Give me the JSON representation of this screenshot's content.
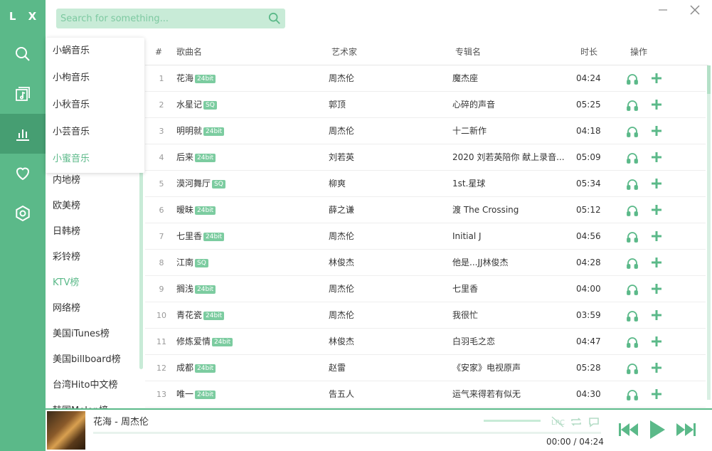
{
  "app": {
    "logo": "L X"
  },
  "colors": {
    "accent": "#5bb989",
    "accent_dark": "#469e72",
    "accent_light": "#c8ebd7"
  },
  "nav": [
    {
      "icon": "search-icon"
    },
    {
      "icon": "music-library-icon"
    },
    {
      "icon": "chart-icon",
      "active": true
    },
    {
      "icon": "heart-icon"
    },
    {
      "icon": "settings-icon"
    }
  ],
  "search": {
    "placeholder": "Search for something..."
  },
  "dropdown": {
    "items": [
      "小蜗音乐",
      "小枸音乐",
      "小秋音乐",
      "小芸音乐",
      "小蜜音乐"
    ],
    "selected": "小蜜音乐"
  },
  "boards": {
    "items": [
      "内地榜",
      "欧美榜",
      "日韩榜",
      "彩铃榜",
      "KTV榜",
      "网络榜",
      "美国iTunes榜",
      "美国billboard榜",
      "台湾Hito中文榜",
      "韩国Melon榜"
    ],
    "selected": "KTV榜"
  },
  "table": {
    "headers": {
      "idx": "#",
      "name": "歌曲名",
      "artist": "艺术家",
      "album": "专辑名",
      "duration": "时长",
      "actions": "操作"
    },
    "rows": [
      {
        "idx": "1",
        "name": "花海",
        "badge": "24bit",
        "artist": "周杰伦",
        "album": "魔杰座",
        "duration": "04:24"
      },
      {
        "idx": "2",
        "name": "水星记",
        "badge": "SQ",
        "artist": "郭顶",
        "album": "心碎的声音",
        "duration": "05:25"
      },
      {
        "idx": "3",
        "name": "明明就",
        "badge": "24bit",
        "artist": "周杰伦",
        "album": "十二新作",
        "duration": "04:18"
      },
      {
        "idx": "4",
        "name": "后来",
        "badge": "24bit",
        "artist": "刘若英",
        "album": "2020 刘若英陪你 献上录音...",
        "duration": "05:09"
      },
      {
        "idx": "5",
        "name": "漠河舞厅",
        "badge": "SQ",
        "artist": "柳爽",
        "album": "1st.星球",
        "duration": "05:34"
      },
      {
        "idx": "6",
        "name": "暧昧",
        "badge": "24bit",
        "artist": "薛之谦",
        "album": "渡 The Crossing",
        "duration": "05:12"
      },
      {
        "idx": "7",
        "name": "七里香",
        "badge": "24bit",
        "artist": "周杰伦",
        "album": "Initial J",
        "duration": "04:56"
      },
      {
        "idx": "8",
        "name": "江南",
        "badge": "SQ",
        "artist": "林俊杰",
        "album": "他是...JJ林俊杰",
        "duration": "04:28"
      },
      {
        "idx": "9",
        "name": "搁浅",
        "badge": "24bit",
        "artist": "周杰伦",
        "album": "七里香",
        "duration": "04:00"
      },
      {
        "idx": "10",
        "name": "青花瓷",
        "badge": "24bit",
        "artist": "周杰伦",
        "album": "我很忙",
        "duration": "03:59"
      },
      {
        "idx": "11",
        "name": "修炼爱情",
        "badge": "24bit",
        "artist": "林俊杰",
        "album": "白羽毛之恋",
        "duration": "04:47"
      },
      {
        "idx": "12",
        "name": "成都",
        "badge": "24bit",
        "artist": "赵雷",
        "album": "《安家》电视原声",
        "duration": "05:28"
      },
      {
        "idx": "13",
        "name": "唯一",
        "badge": "24bit",
        "artist": "告五人",
        "album": "运气来得若有似无",
        "duration": "04:30"
      }
    ]
  },
  "player": {
    "title": "花海 - 周杰伦",
    "current_time": "00:00",
    "separator": "/",
    "total_time": "04:24",
    "progress": 0
  }
}
